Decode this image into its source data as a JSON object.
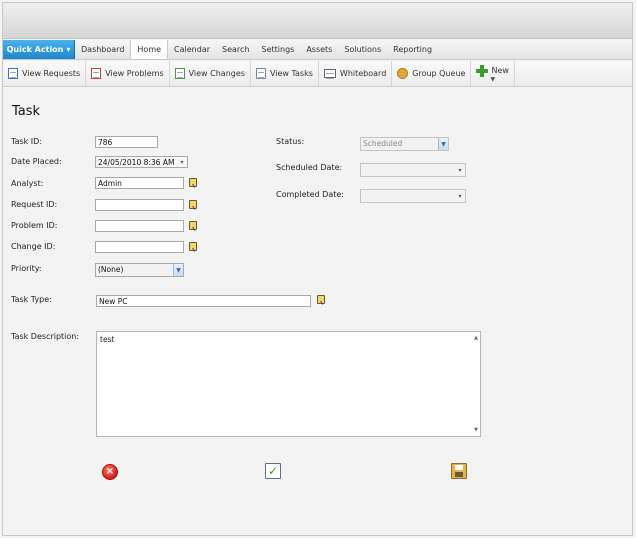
{
  "menu": {
    "quick_action": "Quick Action",
    "items": [
      "Dashboard",
      "Home",
      "Calendar",
      "Search",
      "Settings",
      "Assets",
      "Solutions",
      "Reporting"
    ],
    "active": "Home"
  },
  "toolbar": {
    "view_requests": "View Requests",
    "view_problems": "View Problems",
    "view_changes": "View Changes",
    "view_tasks": "View Tasks",
    "whiteboard": "Whiteboard",
    "group_queue": "Group Queue",
    "new": "New"
  },
  "page": {
    "title": "Task"
  },
  "form": {
    "task_id": {
      "label": "Task ID:",
      "value": "786"
    },
    "date_placed": {
      "label": "Date Placed:",
      "value": "24/05/2010 8:36 AM"
    },
    "analyst": {
      "label": "Analyst:",
      "value": "Admin"
    },
    "request_id": {
      "label": "Request ID:",
      "value": ""
    },
    "problem_id": {
      "label": "Problem ID:",
      "value": ""
    },
    "change_id": {
      "label": "Change ID:",
      "value": ""
    },
    "priority": {
      "label": "Priority:",
      "value": "(None)"
    },
    "status": {
      "label": "Status:",
      "value": "Scheduled"
    },
    "scheduled_date": {
      "label": "Scheduled Date:",
      "value": ""
    },
    "completed_date": {
      "label": "Completed Date:",
      "value": ""
    },
    "task_type": {
      "label": "Task Type:",
      "value": "New PC"
    },
    "task_description": {
      "label": "Task Description:",
      "value": "test"
    }
  },
  "colors": {
    "quick_action_bg": "#1d87cc",
    "cancel_red": "#d21f1a",
    "check_green": "#2f9e2f"
  }
}
